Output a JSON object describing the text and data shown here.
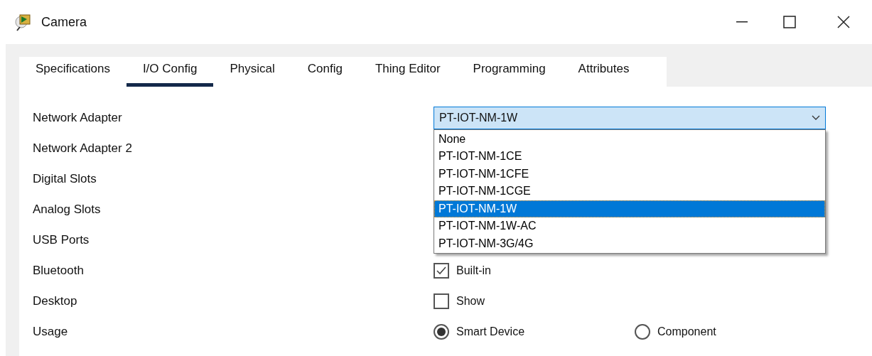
{
  "window": {
    "title": "Camera"
  },
  "tabs": [
    {
      "label": "Specifications",
      "selected": false
    },
    {
      "label": "I/O Config",
      "selected": true
    },
    {
      "label": "Physical",
      "selected": false
    },
    {
      "label": "Config",
      "selected": false
    },
    {
      "label": "Thing Editor",
      "selected": false
    },
    {
      "label": "Programming",
      "selected": false
    },
    {
      "label": "Attributes",
      "selected": false
    }
  ],
  "rows": [
    {
      "label": "Network Adapter",
      "kind": "dropdown",
      "value": "PT-IOT-NM-1W",
      "expanded": true,
      "options": [
        {
          "label": "None",
          "selected": false
        },
        {
          "label": "PT-IOT-NM-1CE",
          "selected": false
        },
        {
          "label": "PT-IOT-NM-1CFE",
          "selected": false
        },
        {
          "label": "PT-IOT-NM-1CGE",
          "selected": false
        },
        {
          "label": "PT-IOT-NM-1W",
          "selected": true
        },
        {
          "label": "PT-IOT-NM-1W-AC",
          "selected": false
        },
        {
          "label": "PT-IOT-NM-3G/4G",
          "selected": false
        }
      ]
    },
    {
      "label": "Network Adapter 2",
      "kind": "hidden"
    },
    {
      "label": "Digital Slots",
      "kind": "hidden"
    },
    {
      "label": "Analog Slots",
      "kind": "hidden"
    },
    {
      "label": "USB Ports",
      "kind": "hidden"
    },
    {
      "label": "Bluetooth",
      "kind": "checkbox",
      "text": "Built-in",
      "checked": true
    },
    {
      "label": "Desktop",
      "kind": "checkbox",
      "text": "Show",
      "checked": false
    },
    {
      "label": "Usage",
      "kind": "radio",
      "choices": [
        {
          "label": "Smart Device",
          "selected": true
        },
        {
          "label": "Component",
          "selected": false
        }
      ]
    }
  ]
}
